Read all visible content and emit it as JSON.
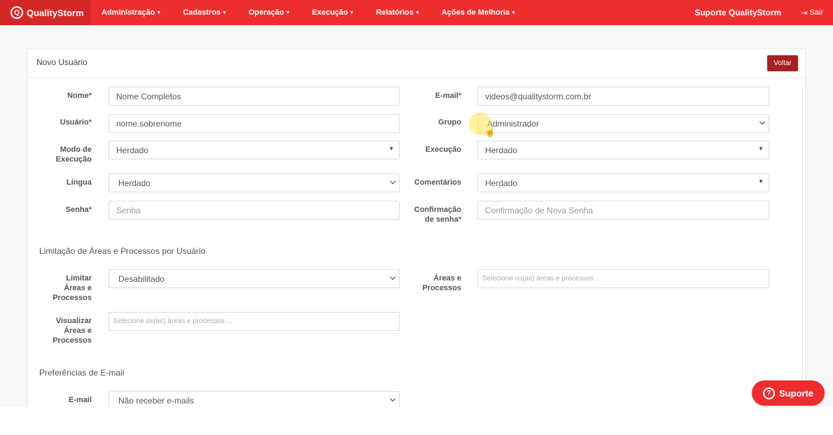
{
  "navbar": {
    "brand": "QualityStorm",
    "menu": [
      "Administração",
      "Cadastros",
      "Operação",
      "Execução",
      "Relatórios",
      "Ações de Melhoria"
    ],
    "support_link": "Suporte QualityStorm",
    "logout": "Sair"
  },
  "panel": {
    "title": "Novo Usuário",
    "back_label": "Voltar"
  },
  "form": {
    "nome": {
      "label": "Nome",
      "value": "Nome Completos"
    },
    "email": {
      "label": "E-mail",
      "value": "videos@qualitystorm.com.br"
    },
    "usuario": {
      "label": "Usuário",
      "value": "nome.sobrenome"
    },
    "grupo": {
      "label": "Grupo",
      "value": "Administrador"
    },
    "modo_execucao": {
      "label_line1": "Modo de",
      "label_line2": "Execução",
      "value": "Herdado"
    },
    "execucao": {
      "label": "Execução",
      "value": "Herdado"
    },
    "lingua": {
      "label": "Língua",
      "value": "Herdado"
    },
    "comentarios": {
      "label": "Comentários",
      "value": "Herdado"
    },
    "senha": {
      "label": "Senha",
      "placeholder": "Senha"
    },
    "confirmacao": {
      "label_line1": "Confirmação",
      "label_line2": "de senha",
      "placeholder": "Confirmação de Nova Senha"
    }
  },
  "limitation": {
    "section_title": "Limitação de Áreas e Processos por Usuário",
    "limitar": {
      "label_line1": "Limitar",
      "label_line2": "Áreas e",
      "label_line3": "Processos",
      "value": "Desabilitado"
    },
    "areas": {
      "label_line1": "Áreas e",
      "label_line2": "Processos",
      "placeholder": "Selecione os(as) áreas e processos ..."
    },
    "visualizar": {
      "label_line1": "Visualizar",
      "label_line2": "Áreas e",
      "label_line3": "Processos",
      "placeholder": "Selecione os(as) áreas e processos ..."
    }
  },
  "email_prefs": {
    "section_title": "Preferências de E-mail",
    "email": {
      "label": "E-mail",
      "value": "Não receber e-mails"
    }
  },
  "support_button": "Suporte",
  "required_marker": "*"
}
